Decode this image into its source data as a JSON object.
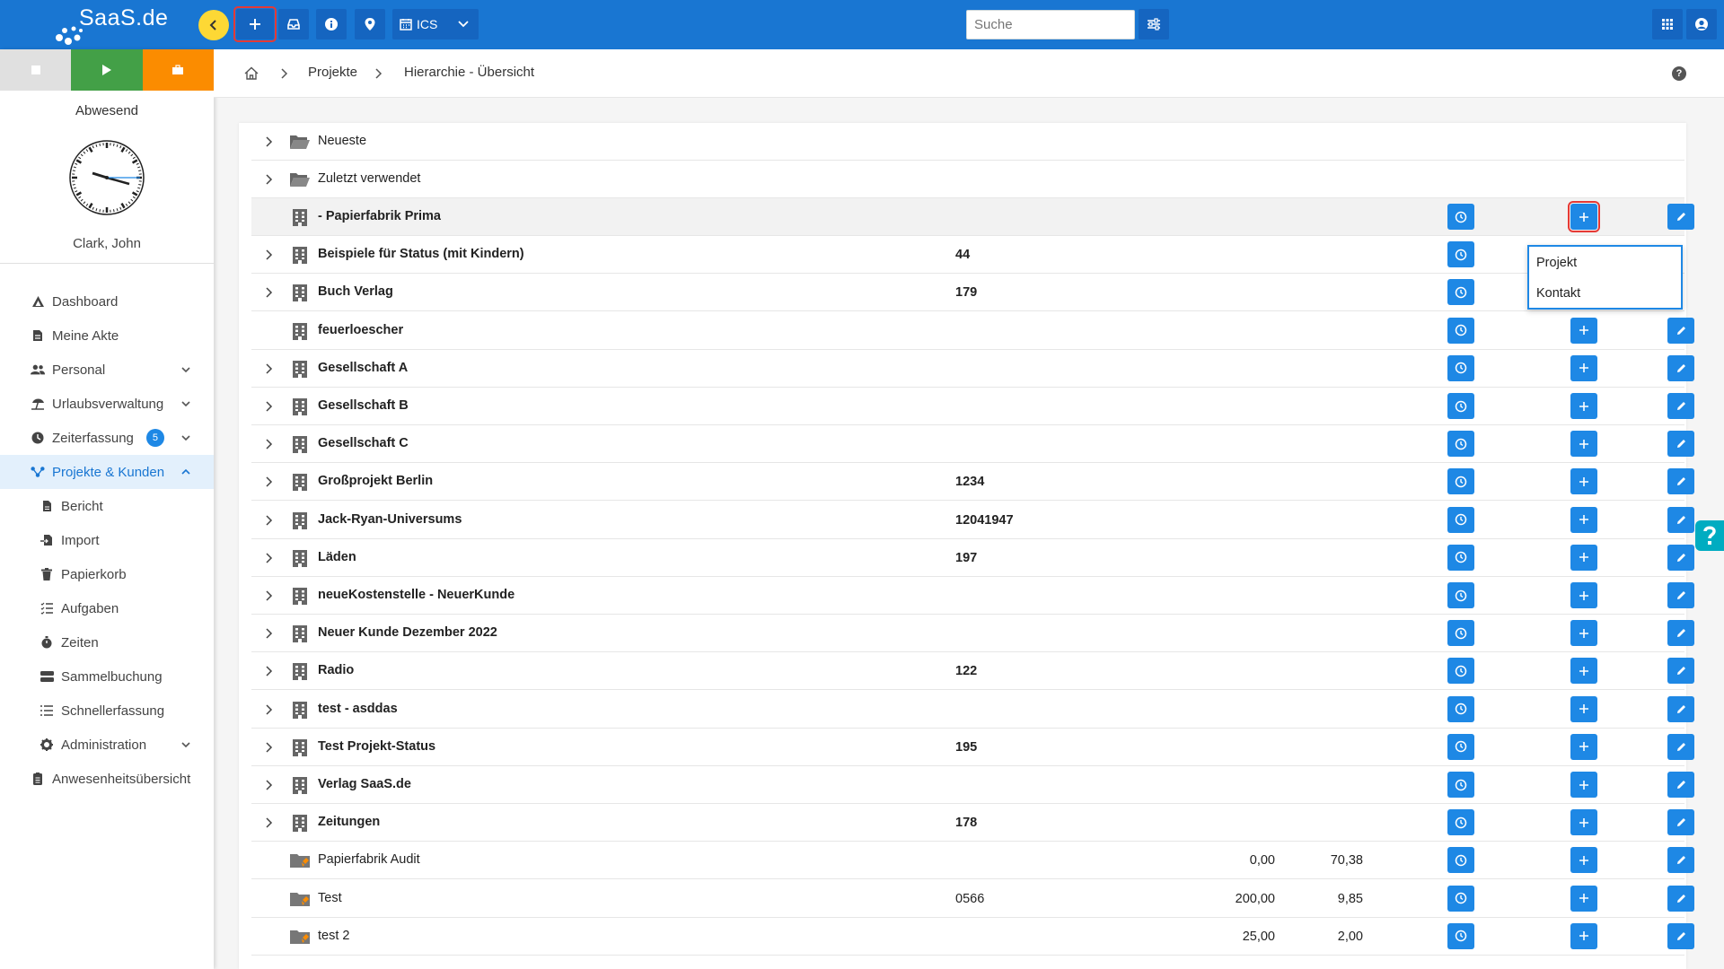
{
  "app": {
    "logo_text": "SaaS.de"
  },
  "colors": {
    "primary": "#1976d2",
    "accent_yellow": "#fdd835",
    "button_blue": "#1e88e5",
    "status_stop": "#e0e0e0",
    "status_play": "#43a047",
    "status_pause": "#fb8c00",
    "highlight_red": "#e53935"
  },
  "topbar": {
    "ics_label": "ICS",
    "search_placeholder": "Suche"
  },
  "sidebar": {
    "presence": "Abwesend",
    "user": "Clark, John",
    "zeiterfassung_badge": "5",
    "items": [
      {
        "label": "Dashboard",
        "icon": "dashboard-icon"
      },
      {
        "label": "Meine Akte",
        "icon": "file-icon"
      },
      {
        "label": "Personal",
        "icon": "users-icon"
      },
      {
        "label": "Urlaubsverwaltung",
        "icon": "beach-icon"
      },
      {
        "label": "Zeiterfassung",
        "icon": "clock-icon"
      },
      {
        "label": "Projekte & Kunden",
        "icon": "sitemap-icon"
      },
      {
        "label": "Bericht",
        "icon": "report-icon"
      },
      {
        "label": "Import",
        "icon": "import-icon"
      },
      {
        "label": "Papierkorb",
        "icon": "trash-icon"
      },
      {
        "label": "Aufgaben",
        "icon": "tasks-icon"
      },
      {
        "label": "Zeiten",
        "icon": "stopwatch-icon"
      },
      {
        "label": "Sammelbuchung",
        "icon": "stack-icon"
      },
      {
        "label": "Schnellerfassung",
        "icon": "list-icon"
      },
      {
        "label": "Administration",
        "icon": "gear-icon"
      },
      {
        "label": "Anwesenheitsübersicht",
        "icon": "badge-icon"
      }
    ]
  },
  "breadcrumb": {
    "level1": "Projekte",
    "level2": "Hierarchie - Übersicht"
  },
  "tree": [
    {
      "name": "Neueste",
      "num": "",
      "v1": "",
      "v2": ""
    },
    {
      "name": "Zuletzt verwendet",
      "num": "",
      "v1": "",
      "v2": ""
    },
    {
      "name": "- Papierfabrik Prima",
      "num": "",
      "v1": "",
      "v2": ""
    },
    {
      "name": "Beispiele für Status (mit Kindern)",
      "num": "44",
      "v1": "",
      "v2": ""
    },
    {
      "name": "Buch Verlag",
      "num": "179",
      "v1": "",
      "v2": ""
    },
    {
      "name": "feuerloescher",
      "num": "",
      "v1": "",
      "v2": ""
    },
    {
      "name": "Gesellschaft A",
      "num": "",
      "v1": "",
      "v2": ""
    },
    {
      "name": "Gesellschaft B",
      "num": "",
      "v1": "",
      "v2": ""
    },
    {
      "name": "Gesellschaft C",
      "num": "",
      "v1": "",
      "v2": ""
    },
    {
      "name": "Großprojekt Berlin",
      "num": "1234",
      "v1": "",
      "v2": ""
    },
    {
      "name": "Jack-Ryan-Universums",
      "num": "12041947",
      "v1": "",
      "v2": ""
    },
    {
      "name": "Läden",
      "num": "197",
      "v1": "",
      "v2": ""
    },
    {
      "name": "neueKostenstelle - NeuerKunde",
      "num": "",
      "v1": "",
      "v2": ""
    },
    {
      "name": "Neuer Kunde Dezember 2022",
      "num": "",
      "v1": "",
      "v2": ""
    },
    {
      "name": "Radio",
      "num": "122",
      "v1": "",
      "v2": ""
    },
    {
      "name": "test - asddas",
      "num": "",
      "v1": "",
      "v2": ""
    },
    {
      "name": "Test Projekt-Status",
      "num": "195",
      "v1": "",
      "v2": ""
    },
    {
      "name": "Verlag SaaS.de",
      "num": "",
      "v1": "",
      "v2": ""
    },
    {
      "name": "Zeitungen",
      "num": "178",
      "v1": "",
      "v2": ""
    },
    {
      "name": "Papierfabrik Audit",
      "num": "",
      "v1": "0,00",
      "v2": "70,38"
    },
    {
      "name": "Test",
      "num": "0566",
      "v1": "200,00",
      "v2": "9,85"
    },
    {
      "name": "test 2",
      "num": "",
      "v1": "25,00",
      "v2": "2,00"
    }
  ],
  "dropdown": {
    "options": [
      "Projekt",
      "Kontakt"
    ]
  }
}
